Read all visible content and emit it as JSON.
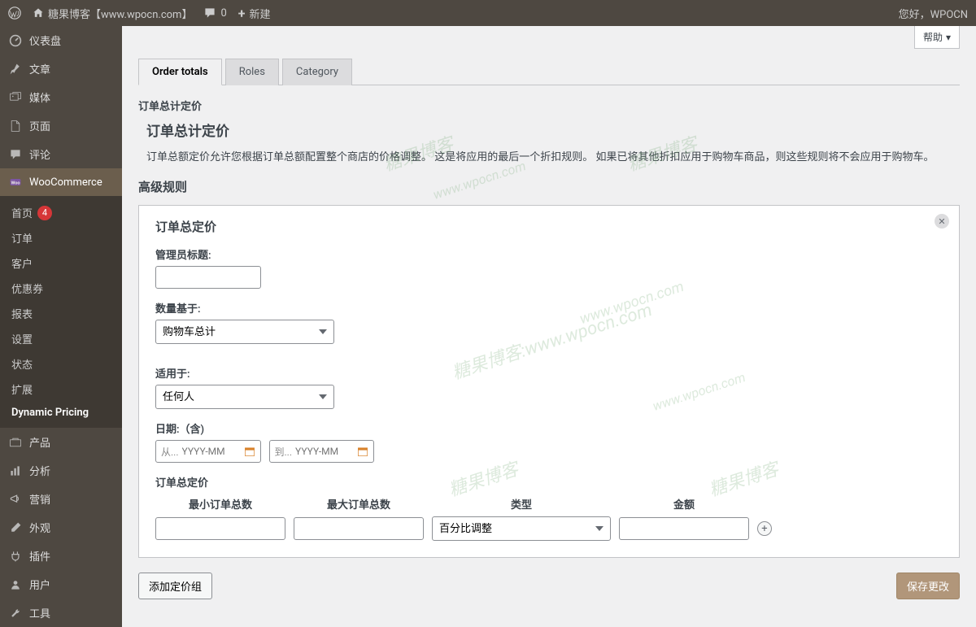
{
  "topbar": {
    "site_name": "糖果博客【www.wpocn.com】",
    "comments_count": "0",
    "new_label": "新建",
    "greeting": "您好，WPOCN"
  },
  "help_label": "帮助",
  "sidebar": {
    "dashboard": "仪表盘",
    "posts": "文章",
    "media": "媒体",
    "pages": "页面",
    "comments": "评论",
    "woocommerce": "WooCommerce",
    "wc_sub": {
      "home": "首页",
      "home_badge": "4",
      "orders": "订单",
      "customers": "客户",
      "coupons": "优惠券",
      "reports": "报表",
      "settings": "设置",
      "status": "状态",
      "extensions": "扩展",
      "dynamic_pricing": "Dynamic Pricing"
    },
    "products": "产品",
    "analytics": "分析",
    "marketing": "营销",
    "appearance": "外观",
    "plugins": "插件",
    "users": "用户",
    "tools": "工具"
  },
  "tabs": {
    "order_totals": "Order totals",
    "roles": "Roles",
    "category": "Category"
  },
  "page": {
    "breadcrumb": "订单总计定价",
    "heading": "订单总计定价",
    "desc": "订单总额定价允许您根据订单总额配置整个商店的价格调整。 这是将应用的最后一个折扣规则。 如果已将其他折扣应用于购物车商品，则这些规则将不会应用于购物车。",
    "rules_label": "高级规则"
  },
  "rule": {
    "title": "订单总定价",
    "admin_title_label": "管理员标题:",
    "qty_based_label": "数量基于:",
    "qty_based_value": "购物车总计",
    "applies_label": "适用于:",
    "applies_value": "任何人",
    "date_label": "日期:（含)",
    "date_from_prefix": "从...",
    "date_to_prefix": "到...",
    "date_placeholder": "YYYY-MM",
    "table_title": "订单总定价",
    "cols": {
      "min": "最小订单总数",
      "max": "最大订单总数",
      "type": "类型",
      "amount": "金额"
    },
    "type_value": "百分比调整"
  },
  "buttons": {
    "add_group": "添加定价组",
    "save": "保存更改"
  },
  "watermarks": {
    "text1": "糖果博客:www.wpocn.com",
    "text2": "www.wpocn.com",
    "text3": "糖果博客"
  }
}
